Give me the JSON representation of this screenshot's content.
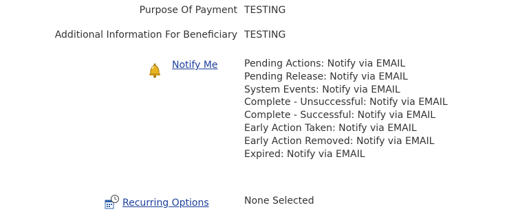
{
  "fields": [
    {
      "label": "Purpose Of Payment",
      "value": "TESTING"
    },
    {
      "label": "Additional Information For Beneficiary",
      "value": "TESTING"
    }
  ],
  "notify": {
    "link_label": "Notify Me",
    "icon": "bell-icon",
    "settings": [
      "Pending Actions: Notify via EMAIL",
      "Pending Release: Notify via EMAIL",
      "System Events: Notify via EMAIL",
      "Complete - Unsuccessful: Notify via EMAIL",
      "Complete - Successful: Notify via EMAIL",
      "Early Action Taken: Notify via EMAIL",
      "Early Action Removed: Notify via EMAIL",
      "Expired: Notify via EMAIL"
    ]
  },
  "recurring": {
    "link_label": "Recurring Options",
    "icon": "recurring-calendar-icon",
    "value": "None Selected"
  },
  "colors": {
    "link": "#1a3e9a",
    "text": "#333333"
  }
}
